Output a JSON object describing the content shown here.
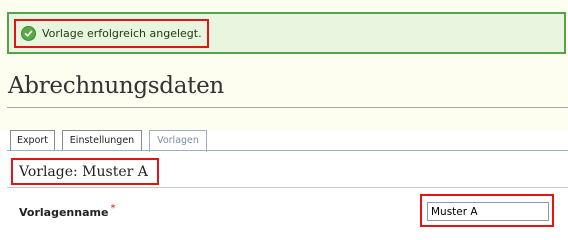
{
  "notification": {
    "message": "Vorlage erfolgreich angelegt."
  },
  "page": {
    "title": "Abrechnungsdaten"
  },
  "tabs": [
    {
      "label": "Export",
      "active": false
    },
    {
      "label": "Einstellungen",
      "active": false
    },
    {
      "label": "Vorlagen",
      "active": true
    }
  ],
  "section": {
    "title": "Vorlage: Muster A"
  },
  "form": {
    "name_label": "Vorlagenname",
    "required_mark": "*",
    "name_value": "Muster A"
  },
  "colors": {
    "success_bg": "#e8f6df",
    "success_border": "#55a14a",
    "highlight": "#e01616",
    "active_tab_text": "#7a8ea6"
  },
  "icons": {
    "notification": "checkmark-circle-icon"
  }
}
